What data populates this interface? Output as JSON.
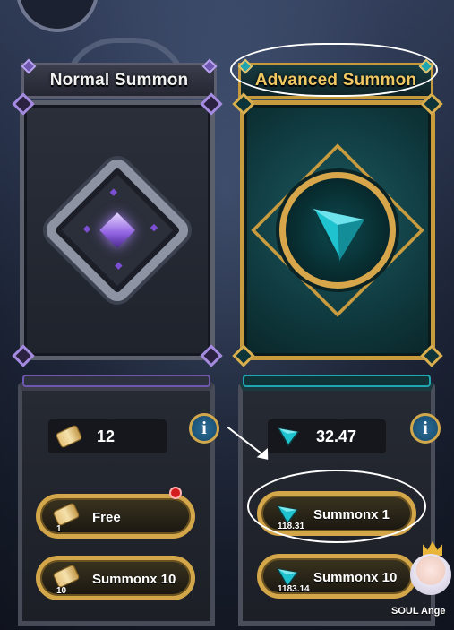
{
  "tabs": {
    "normal_label": "Normal Summon",
    "advanced_label": "Advanced Summon"
  },
  "normal_panel": {
    "currency_icon": "scroll-icon",
    "currency_count": "12",
    "info_label": "i",
    "free_button": {
      "label": "Free",
      "cost": "1",
      "has_notification": true
    },
    "summon10_button": {
      "label": "Summonx 10",
      "cost": "10"
    }
  },
  "advanced_panel": {
    "currency_icon": "tron-crystal-icon",
    "currency_count": "32.47",
    "info_label": "i",
    "summon1_button": {
      "label": "Summonx 1",
      "cost": "118.31"
    },
    "summon10_button": {
      "label": "Summonx 10",
      "cost": "1183.14"
    }
  },
  "companion": {
    "name": "SOUL Ange"
  },
  "colors": {
    "gold": "#d4a64a",
    "teal": "#1fa6b0",
    "purple": "#8e5fe0",
    "red_dot": "#d41c1c",
    "advanced_title": "#f0c863"
  }
}
